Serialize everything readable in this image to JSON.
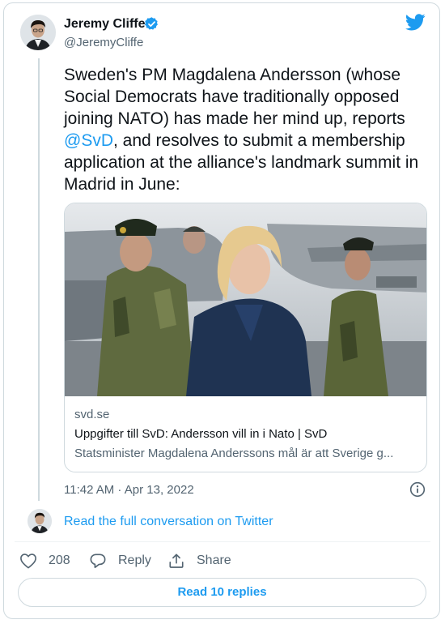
{
  "author": {
    "name": "Jeremy Cliffe",
    "handle": "@JeremyCliffe"
  },
  "tweet": {
    "text_before": "Sweden's PM Magdalena Andersson (whose Social Democrats have traditionally opposed joining NATO) has made her mind up, reports ",
    "mention": "@SvD",
    "text_after": ", and resolves to submit a membership application at the alliance's landmark summit in Madrid in June:",
    "timestamp": "11:42 AM · Apr 13, 2022"
  },
  "link_card": {
    "domain": "svd.se",
    "title": "Uppgifter till SvD: Andersson vill in i Nato | SvD",
    "description": "Statsminister Magdalena Anderssons mål är att Sverige g..."
  },
  "conversation": {
    "link_label": "Read the full conversation on Twitter"
  },
  "actions": {
    "like_count": "208",
    "reply_label": "Reply",
    "share_label": "Share"
  },
  "read_replies_label": "Read 10 replies",
  "icons": {
    "verified": "verified-badge-icon",
    "logo": "twitter-bird-icon",
    "info": "info-icon",
    "like": "heart-icon",
    "reply": "speech-bubble-icon",
    "share": "share-upload-icon"
  },
  "colors": {
    "accent": "#1d9bf0",
    "text": "#0f1419",
    "muted": "#536471",
    "border": "#cfd9de"
  }
}
